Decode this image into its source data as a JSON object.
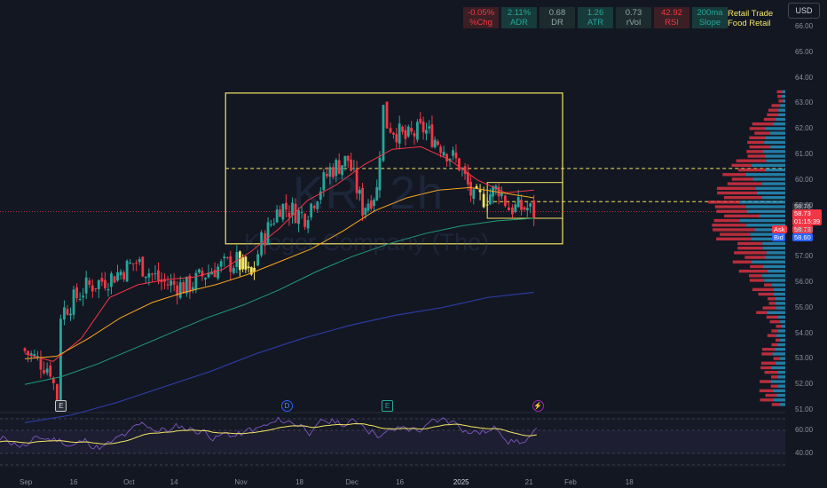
{
  "header": {
    "currency_label": "USD",
    "stats": [
      {
        "value": "-0.05%",
        "label": "%Chg",
        "tone": "red"
      },
      {
        "value": "2.11%",
        "label": "ADR",
        "tone": "teal"
      },
      {
        "value": "0.68",
        "label": "DR",
        "tone": "dark"
      },
      {
        "value": "1.26",
        "label": "ATR",
        "tone": "teal"
      },
      {
        "value": "0.73",
        "label": "rVol",
        "tone": "dark"
      },
      {
        "value": "42.92",
        "label": "RSI",
        "tone": "red"
      },
      {
        "value": "200ma",
        "label": "Slope",
        "tone": "teal"
      }
    ],
    "sector": "Retail Trade",
    "industry": "Food Retail"
  },
  "watermark": {
    "ticker": "KR, 2h",
    "name": "Kroger Company (The)"
  },
  "price_tags": {
    "last": "58.76",
    "current": "58.73",
    "countdown": "01:15:39",
    "ask_label": "Ask",
    "ask": "58.73",
    "bid_label": "Bid",
    "bid": "58.60"
  },
  "events": [
    {
      "symbol": "E",
      "kind": "earnings",
      "date": "2024-09-12"
    },
    {
      "symbol": "D",
      "kind": "dividend",
      "date": "2024-11-14"
    },
    {
      "symbol": "E",
      "kind": "earnings",
      "date": "2024-12-12"
    },
    {
      "symbol": "⚡",
      "kind": "split-news",
      "date": "2025-01-23"
    }
  ],
  "colors": {
    "up": "#26a69a",
    "down": "#f23645",
    "highlight": "#f5e663",
    "ema_fast": "#f23645",
    "ema_slow": "#f7a621",
    "sma50": "#1f9d7a",
    "sma200": "#2b3a9e",
    "rsi": "#7e57c2",
    "rsi_ma": "#f5e663",
    "box": "#f5e663"
  },
  "chart_data": {
    "type": "candlestick",
    "symbol": "KR",
    "timeframe": "2h",
    "y_axis": {
      "min": 50.5,
      "max": 66.5,
      "ticks": [
        "51.00",
        "52.00",
        "53.00",
        "54.00",
        "55.00",
        "56.00",
        "57.00",
        "58.00",
        "59.00",
        "60.00",
        "61.00",
        "62.00",
        "63.00",
        "64.00",
        "65.00",
        "66.00"
      ]
    },
    "x_axis": {
      "ticks": [
        "Sep",
        "16",
        "Oct",
        "14",
        "Nov",
        "18",
        "Dec",
        "16",
        "2025",
        "21",
        "Feb",
        "18"
      ]
    },
    "ohlc_anchors": [
      {
        "t": "2024-09-02",
        "close": 53.4
      },
      {
        "t": "2024-09-10",
        "close": 52.6
      },
      {
        "t": "2024-09-12",
        "close": 51.4
      },
      {
        "t": "2024-09-13",
        "close": 54.8
      },
      {
        "t": "2024-09-20",
        "close": 55.8
      },
      {
        "t": "2024-09-27",
        "close": 56.2
      },
      {
        "t": "2024-10-04",
        "close": 56.8
      },
      {
        "t": "2024-10-11",
        "close": 56.0
      },
      {
        "t": "2024-10-18",
        "close": 55.8
      },
      {
        "t": "2024-10-25",
        "close": 56.5
      },
      {
        "t": "2024-11-01",
        "close": 56.8
      },
      {
        "t": "2024-11-05",
        "close": 56.2
      },
      {
        "t": "2024-11-08",
        "close": 57.6
      },
      {
        "t": "2024-11-13",
        "close": 59.0
      },
      {
        "t": "2024-11-20",
        "close": 58.6
      },
      {
        "t": "2024-11-27",
        "close": 60.4
      },
      {
        "t": "2024-12-02",
        "close": 60.8
      },
      {
        "t": "2024-12-06",
        "close": 58.9
      },
      {
        "t": "2024-12-10",
        "close": 59.6
      },
      {
        "t": "2024-12-12",
        "close": 62.8
      },
      {
        "t": "2024-12-13",
        "close": 62.2
      },
      {
        "t": "2024-12-18",
        "close": 61.6
      },
      {
        "t": "2024-12-23",
        "close": 62.0
      },
      {
        "t": "2024-12-27",
        "close": 61.5
      },
      {
        "t": "2025-01-02",
        "close": 60.6
      },
      {
        "t": "2025-01-06",
        "close": 59.2
      },
      {
        "t": "2025-01-09",
        "close": 59.3
      },
      {
        "t": "2025-01-13",
        "close": 59.7
      },
      {
        "t": "2025-01-16",
        "close": 58.9
      },
      {
        "t": "2025-01-21",
        "close": 58.9
      },
      {
        "t": "2025-01-23",
        "close": 58.73
      }
    ],
    "range_box": {
      "top": 63.4,
      "bottom": 57.5,
      "mid": 60.45
    },
    "consolidation_box": {
      "top": 59.9,
      "bottom": 58.5,
      "mid": 59.15
    },
    "series": [
      {
        "name": "EMA fast",
        "values": [
          53.2,
          52.9,
          53.8,
          55.4,
          55.9,
          56.1,
          56.2,
          56.5,
          57.2,
          58.1,
          59.2,
          59.8,
          60.6,
          61.2,
          61.3,
          60.8,
          60.0,
          59.5,
          59.6
        ]
      },
      {
        "name": "EMA slow",
        "values": [
          53.0,
          53.1,
          53.8,
          54.6,
          55.2,
          55.6,
          55.9,
          56.3,
          56.8,
          57.3,
          58.0,
          58.8,
          59.3,
          59.6,
          59.7,
          59.5,
          59.3
        ]
      },
      {
        "name": "SMA 50",
        "values": [
          52.0,
          52.3,
          52.8,
          53.4,
          54.0,
          54.6,
          55.1,
          55.7,
          56.4,
          57.0,
          57.5,
          57.9,
          58.2,
          58.4,
          58.5
        ]
      },
      {
        "name": "SMA 200",
        "values": [
          50.5,
          50.8,
          51.3,
          51.9,
          52.5,
          53.2,
          53.8,
          54.3,
          54.7,
          55.0,
          55.4,
          55.6
        ]
      }
    ],
    "rsi": {
      "ticks": [
        "60.00",
        "40.00"
      ],
      "upper": 60,
      "lower": 40,
      "last": 42.92
    }
  }
}
